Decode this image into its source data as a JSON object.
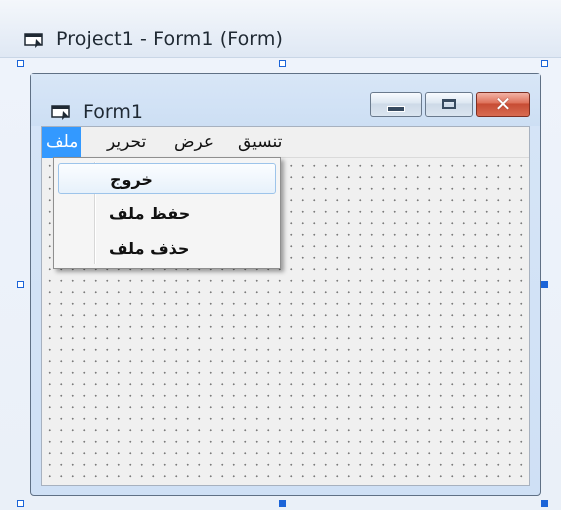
{
  "designer": {
    "title": "Project1 - Form1 (Form)"
  },
  "form": {
    "title": "Form1",
    "caption_buttons": {
      "minimize_icon": "minimize-icon",
      "maximize_icon": "maximize-icon",
      "close_icon": "close-icon",
      "close_glyph": "✕"
    }
  },
  "menubar": {
    "items": [
      {
        "label": "ملف",
        "active": true
      },
      {
        "label": "تحرير",
        "active": false
      },
      {
        "label": "عرض",
        "active": false
      },
      {
        "label": "تنسيق",
        "active": false
      }
    ]
  },
  "dropdown": {
    "items": [
      {
        "label": "خروج",
        "hovered": true
      },
      {
        "label": "حفظ ملف",
        "hovered": false
      },
      {
        "label": "حذف ملف",
        "hovered": false
      }
    ]
  },
  "colors": {
    "menu_highlight": "#3399ff",
    "selection_handles": "#1b64d8",
    "close_button": "#d86c52"
  }
}
